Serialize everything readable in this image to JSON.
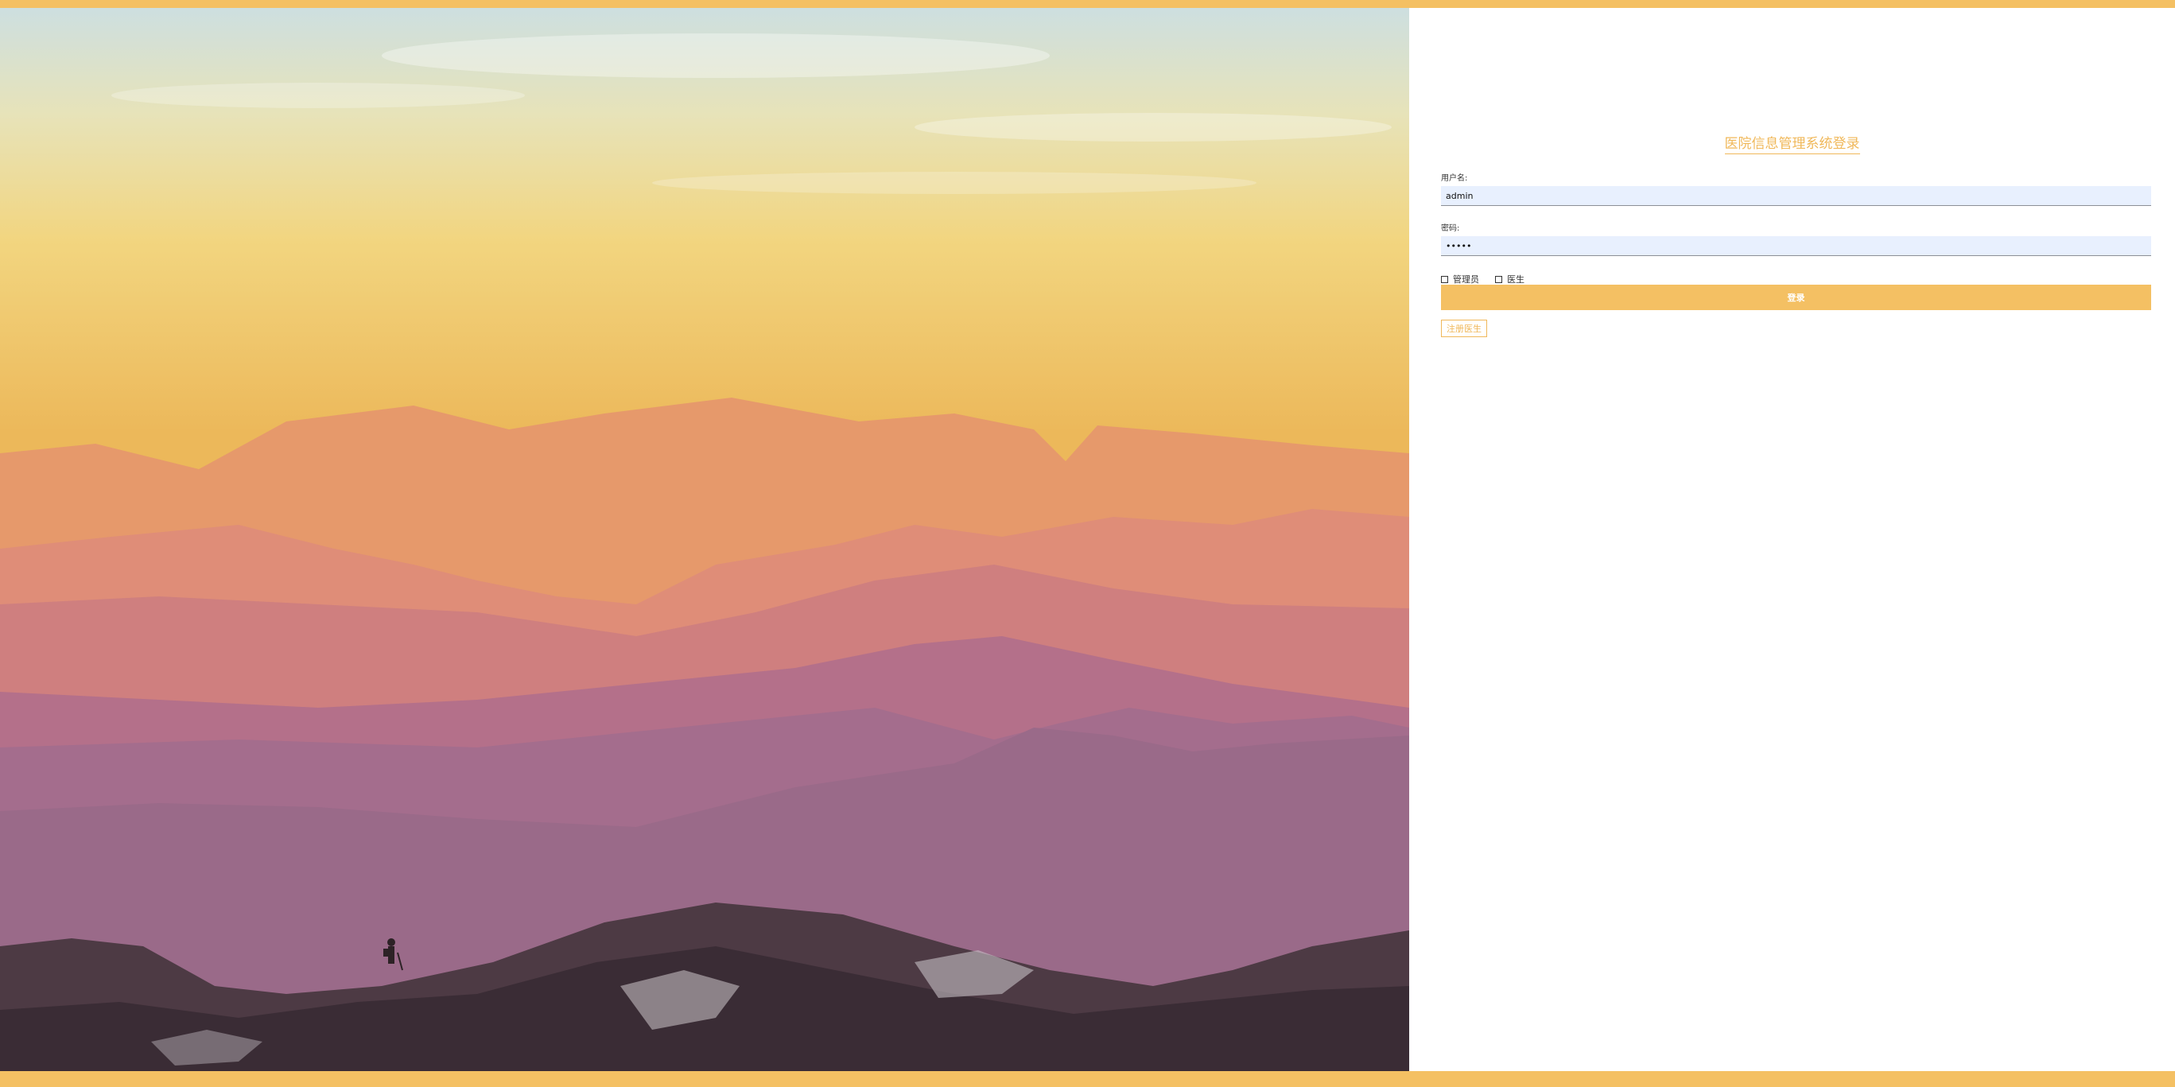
{
  "title": "医院信息管理系统登录",
  "fields": {
    "username_label": "用户名:",
    "username_value": "admin",
    "password_label": "密码:",
    "password_value": "•••••"
  },
  "roles": [
    {
      "label": "管理员",
      "checked": false
    },
    {
      "label": "医生",
      "checked": false
    }
  ],
  "buttons": {
    "login_label": "登录",
    "register_label": "注册医生"
  },
  "colors": {
    "accent": "#f4c063",
    "title": "#f0b85a",
    "input_bg": "#e8f0fe"
  }
}
